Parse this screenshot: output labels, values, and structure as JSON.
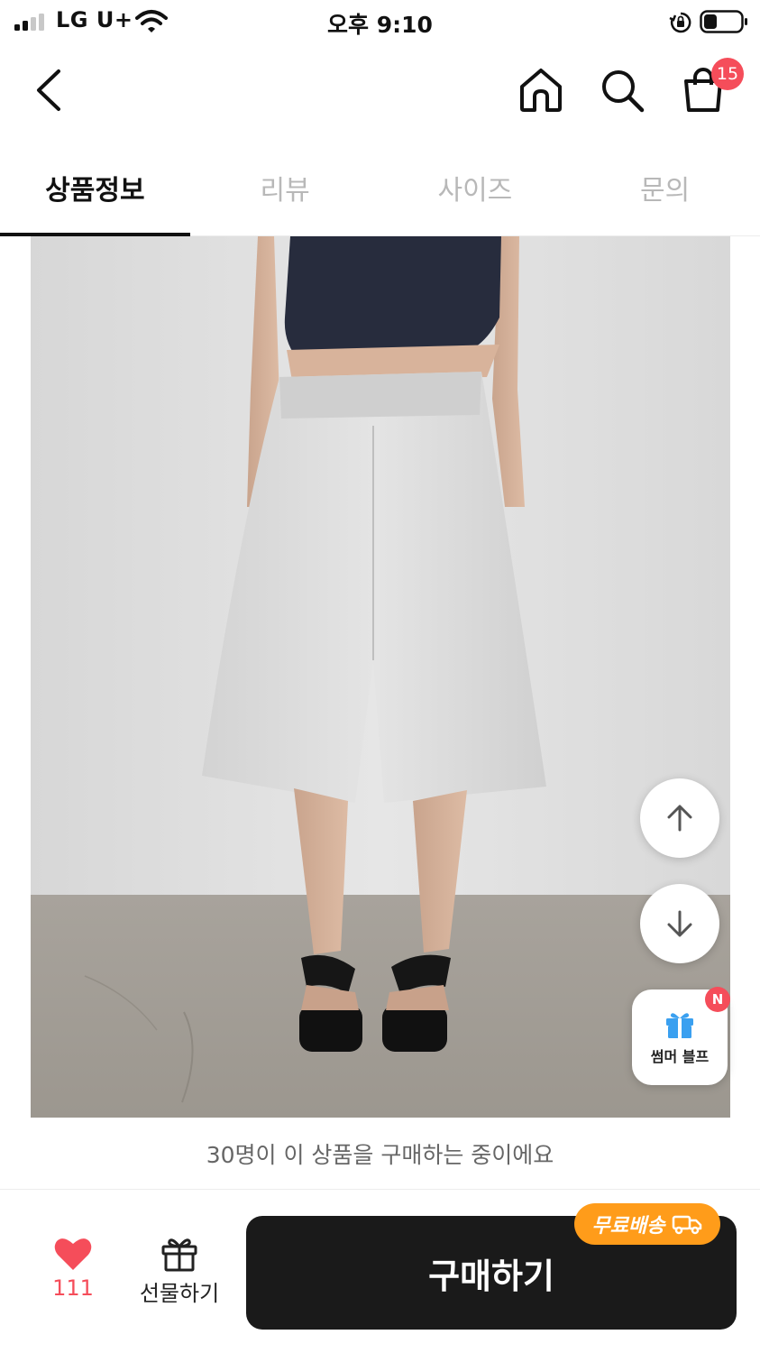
{
  "status_bar": {
    "carrier": "LG U+",
    "time": "오후 9:10"
  },
  "nav": {
    "cart_count": "15"
  },
  "tabs": [
    {
      "label": "상품정보",
      "active": true
    },
    {
      "label": "리뷰",
      "active": false
    },
    {
      "label": "사이즈",
      "active": false
    },
    {
      "label": "문의",
      "active": false
    }
  ],
  "floating": {
    "promo_label": "썸머 블프",
    "promo_badge": "N"
  },
  "buyers_notice": "30명이 이 상품을 구매하는 중이에요",
  "bottom_bar": {
    "like_count": "111",
    "gift_label": "선물하기",
    "buy_label": "구매하기",
    "shipping_badge": "무료배송"
  },
  "colors": {
    "accent": "#f54d5a",
    "buy_button": "#1a1a1a",
    "shipping_badge": "#ff9c1a",
    "promo_icon": "#3aa0f0"
  }
}
